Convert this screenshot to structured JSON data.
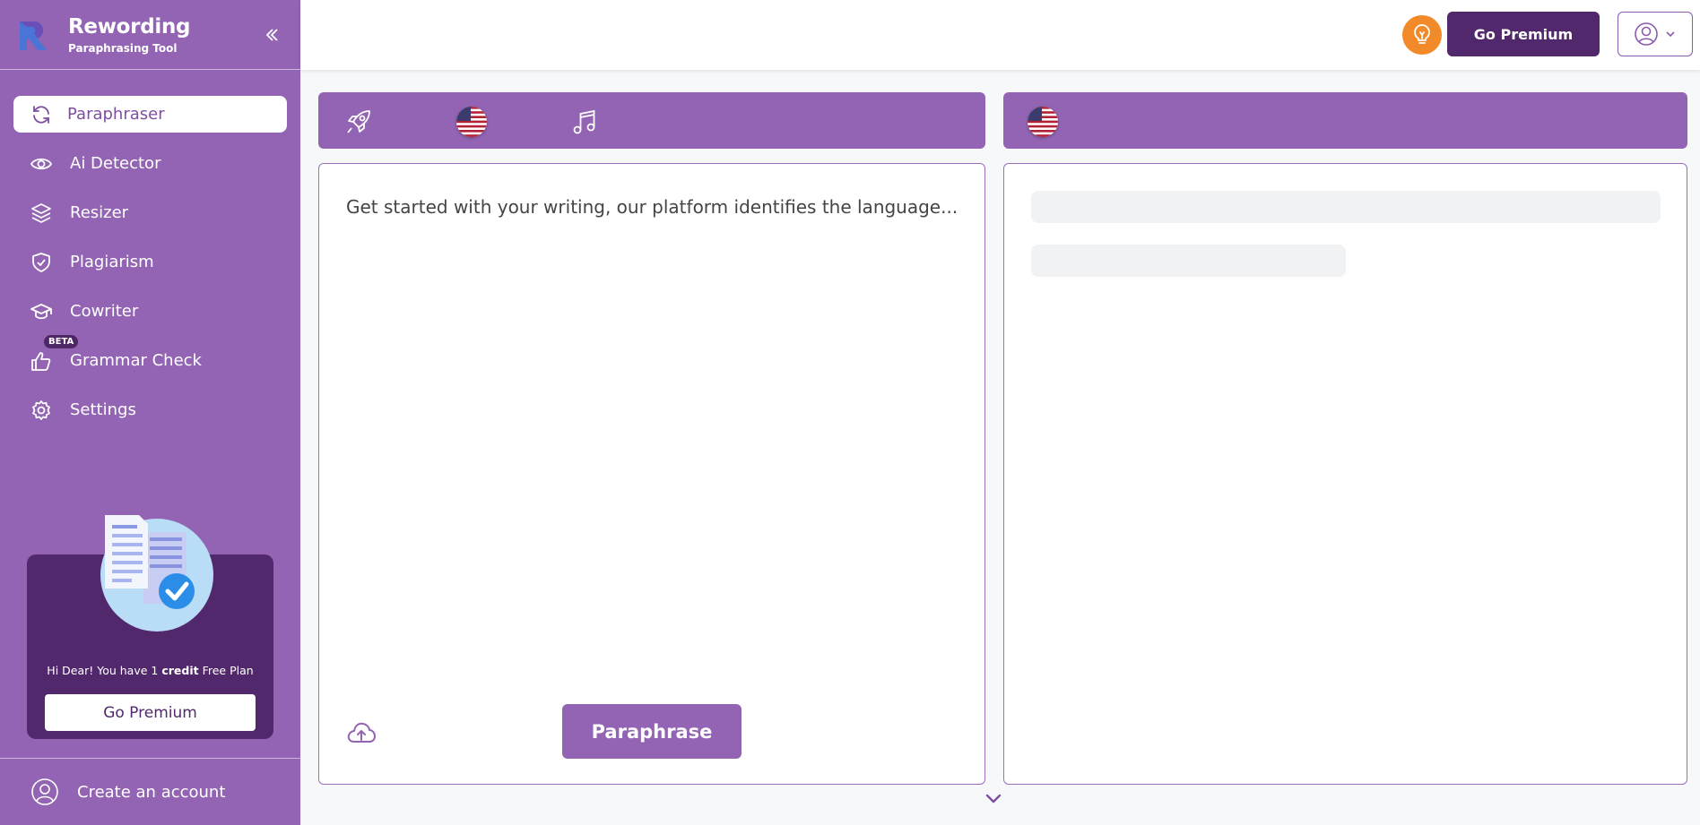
{
  "brand": {
    "name": "Rewording",
    "tagline": "Paraphrasing Tool"
  },
  "sidebar": {
    "items": [
      {
        "label": "Paraphraser",
        "icon": "refresh-icon",
        "active": true
      },
      {
        "label": "Ai Detector",
        "icon": "eye-icon"
      },
      {
        "label": "Resizer",
        "icon": "layers-icon"
      },
      {
        "label": "Plagiarism",
        "icon": "shield-check-icon"
      },
      {
        "label": "Cowriter",
        "icon": "graduation-cap-icon"
      },
      {
        "label": "Grammar Check",
        "icon": "thumbs-up-icon",
        "badge": "BETA"
      },
      {
        "label": "Settings",
        "icon": "gear-icon"
      }
    ],
    "promo": {
      "text_before": "Hi Dear! You have 1 ",
      "text_bold": "credit",
      "text_after": " Free Plan",
      "button": "Go Premium"
    },
    "account": "Create an account"
  },
  "topbar": {
    "premium_button": "Go Premium"
  },
  "editor": {
    "placeholder": "Get started with your writing, our platform identifies the language...",
    "action_button": "Paraphrase"
  },
  "colors": {
    "sidebar": "#9264b3",
    "dark_purple": "#52286c",
    "orange": "#f28a2a"
  }
}
